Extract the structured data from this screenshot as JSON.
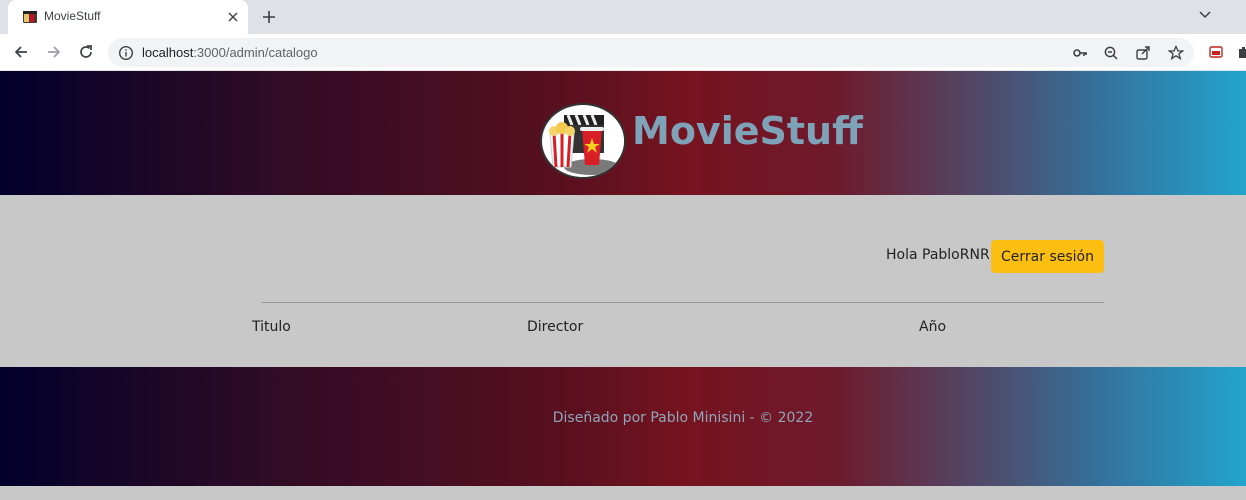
{
  "browser": {
    "tab_title": "MovieStuff",
    "url_host": "localhost",
    "url_path": ":3000/admin/catalogo"
  },
  "site": {
    "brand": "MovieStuff",
    "greeting": "Hola PabloRNR!",
    "logout_label": "Cerrar sesión",
    "table_headers": [
      "Titulo",
      "Director",
      "Año"
    ],
    "footer": "Diseñado por Pablo Minisini - © 2022"
  },
  "colors": {
    "accent": "#fcbf11",
    "brand_text": "#7ea3b8",
    "page_bg": "#c8c8c8"
  }
}
